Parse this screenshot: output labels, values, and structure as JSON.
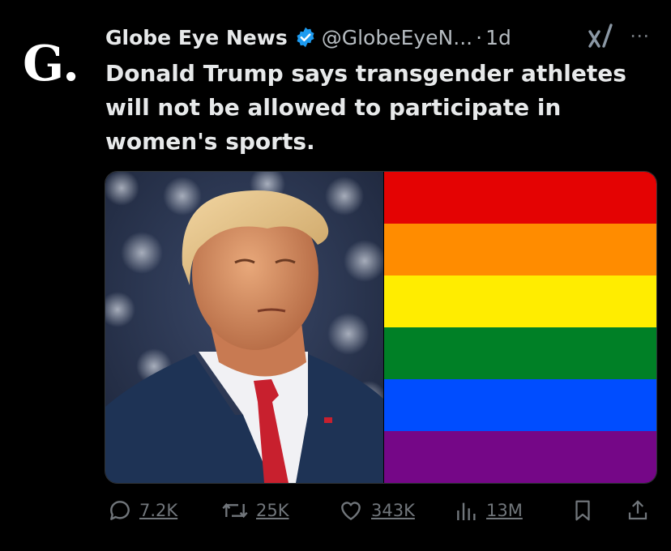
{
  "account": {
    "avatar_letter": "G.",
    "display_name": "Globe Eye News",
    "handle": "@GlobeEyeN...",
    "separator": "·",
    "time": "1d",
    "verified": true,
    "verified_color": "#1d9bf0"
  },
  "tweet": {
    "text": "Donald Trump says transgender athletes will not be allowed to participate in women's sports."
  },
  "media": {
    "left_image": "portrait-photo",
    "right_image": "rainbow-flag",
    "flag_colors": [
      "#e40303",
      "#ff8c00",
      "#ffed00",
      "#008026",
      "#004dff",
      "#750787"
    ]
  },
  "actions": {
    "replies": "7.2K",
    "reposts": "25K",
    "likes": "343K",
    "views": "13M"
  },
  "icons": [
    "verified-badge-icon",
    "grok-icon",
    "more-icon",
    "reply-icon",
    "repost-icon",
    "like-icon",
    "views-icon",
    "bookmark-icon",
    "share-icon"
  ]
}
